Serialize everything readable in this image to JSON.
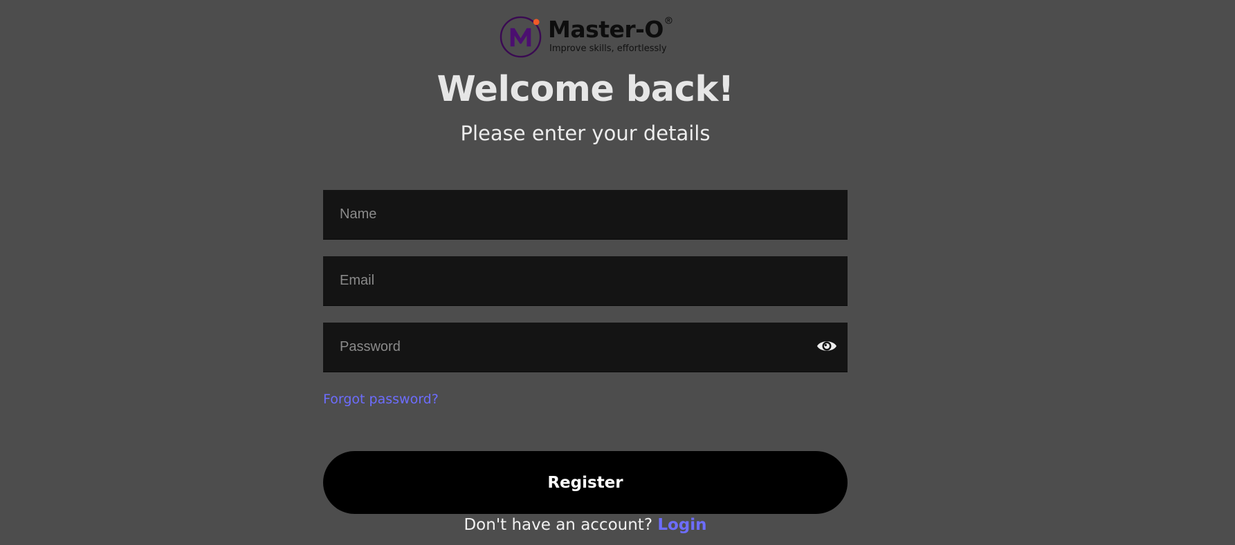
{
  "brand": {
    "name": "Master-O",
    "tagline": "Improve skills, effortlessly",
    "logo_icon": "m-circle-logo-icon",
    "registered_icon": "registered-trademark-icon",
    "colors": {
      "logo_ring": "#3a0a52",
      "logo_letter": "#4b0f70",
      "logo_dot": "#f05a28"
    }
  },
  "heading": {
    "title": "Welcome back!",
    "subtitle": "Please enter your details"
  },
  "form": {
    "name": {
      "placeholder": "Name",
      "value": ""
    },
    "email": {
      "placeholder": "Email",
      "value": ""
    },
    "password": {
      "placeholder": "Password",
      "value": "",
      "toggle_icon": "eye-icon"
    },
    "forgot_label": "Forgot password?",
    "submit_label": "Register"
  },
  "footer": {
    "prompt": "Don't have an account?",
    "link_label": "Login"
  },
  "colors": {
    "background": "#4d4d4d",
    "input_background": "#141414",
    "link": "#6d6dff",
    "button": "#000000"
  }
}
